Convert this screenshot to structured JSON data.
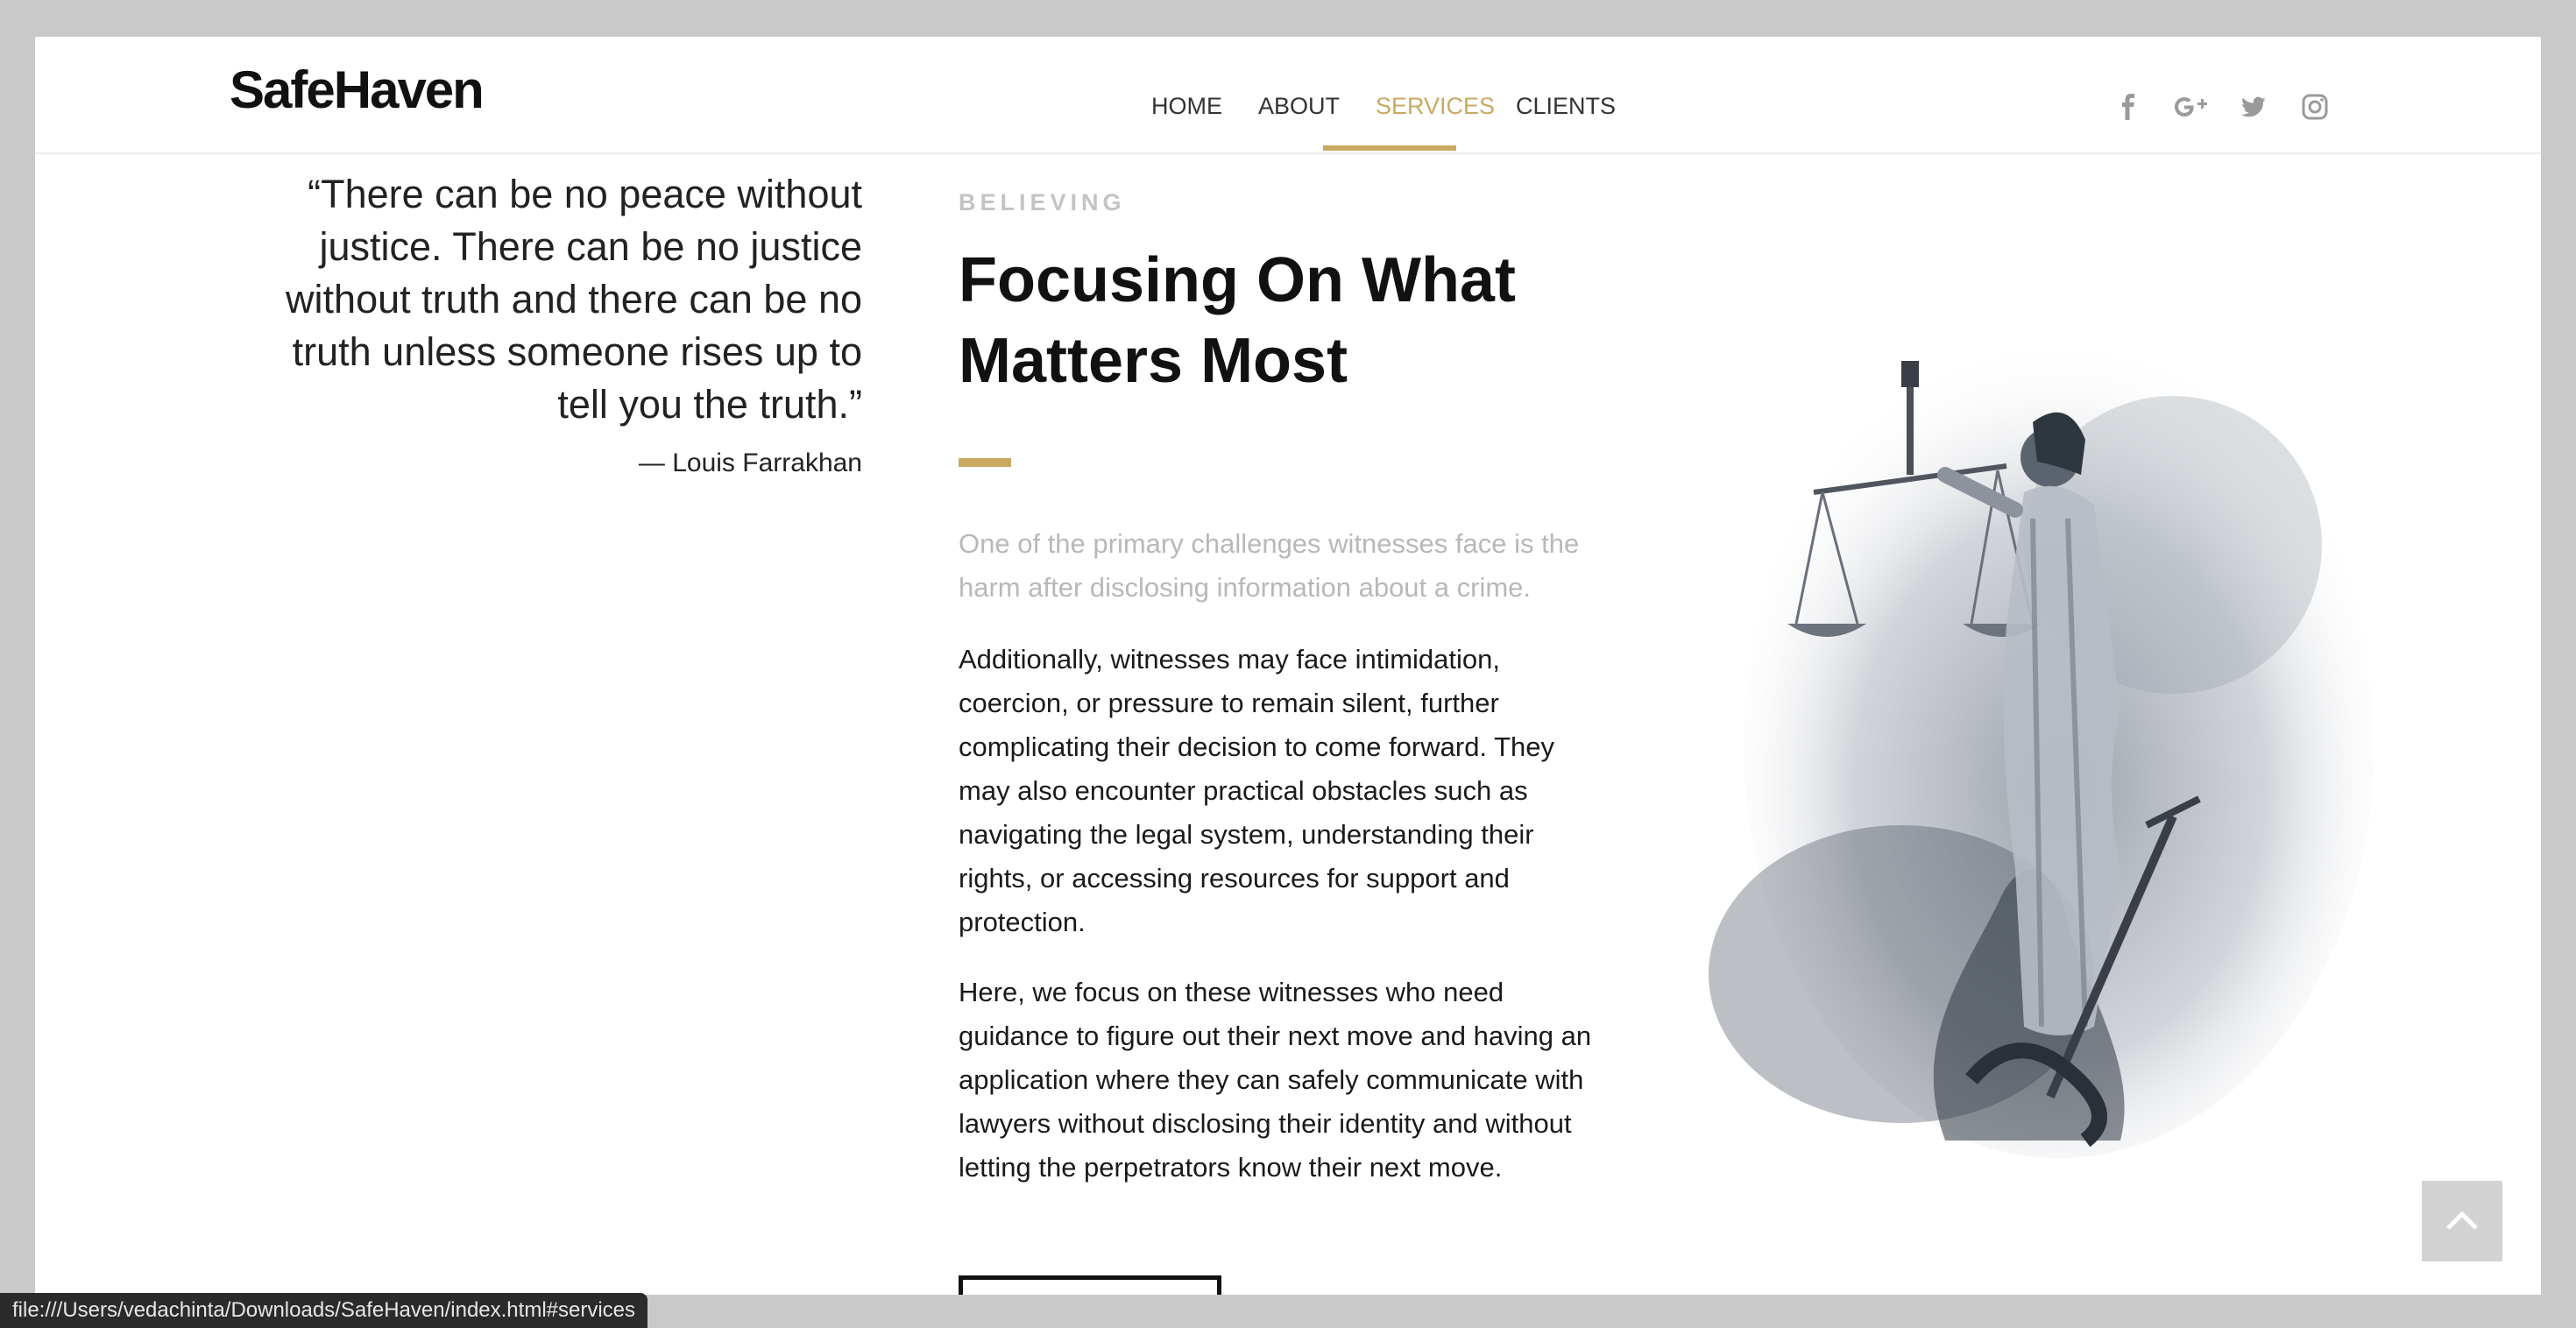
{
  "header": {
    "logo": "SafeHaven",
    "nav": [
      {
        "label": "HOME"
      },
      {
        "label": "ABOUT"
      },
      {
        "label": "SERVICES",
        "active": true
      },
      {
        "label": "CLIENTS"
      }
    ],
    "social_icons": [
      "facebook-icon",
      "google-plus-icon",
      "twitter-icon",
      "instagram-icon"
    ]
  },
  "quote": {
    "lines": [
      "“There can be no peace without",
      "justice. There can be no justice",
      "without truth and there can be no",
      "truth unless someone rises up to",
      "tell you the truth.”"
    ],
    "author": "— Louis Farrakhan"
  },
  "section": {
    "eyebrow": "BELIEVING",
    "headline_lines": [
      "Focusing On What",
      "Matters Most"
    ],
    "lead_lines": [
      "One of the primary challenges witnesses face is the",
      "harm after disclosing information about a crime."
    ],
    "para1_lines": [
      "Additionally, witnesses may face intimidation,",
      "coercion, or pressure to remain silent, further",
      "complicating their decision to come forward. They",
      "may also encounter practical obstacles such as",
      "navigating the legal system, understanding their",
      "rights, or accessing resources for support and",
      "protection."
    ],
    "para2_lines": [
      "Here, we focus on these witnesses who need",
      "guidance to figure out their next move and having an",
      "application where they can safely communicate with",
      "lawyers without disclosing their identity and without",
      "letting the perpetrators know their next move."
    ]
  },
  "colors": {
    "accent": "#c9a962",
    "text": "#1a1a1a",
    "muted": "#b8b8b8"
  },
  "status_bar": {
    "url": "file:///Users/vedachinta/Downloads/SafeHaven/index.html#services"
  }
}
